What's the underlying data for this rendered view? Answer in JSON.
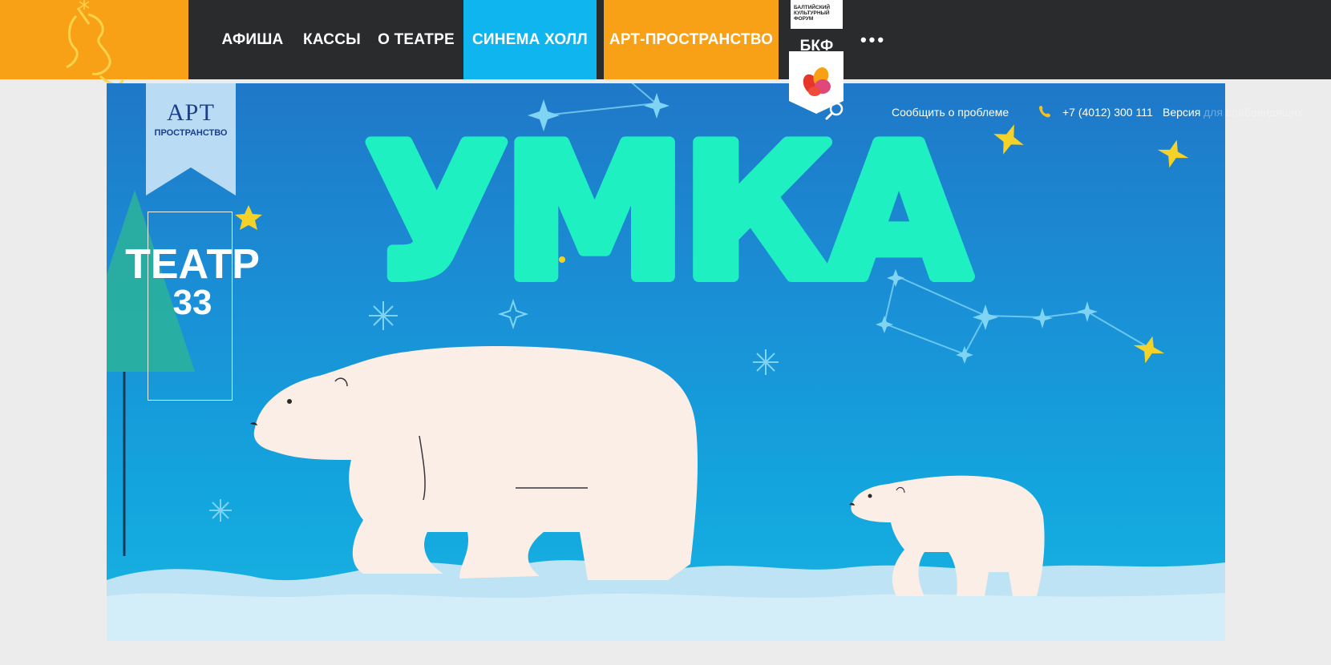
{
  "nav": {
    "items": [
      {
        "label": "АФИША"
      },
      {
        "label": "КАССЫ"
      },
      {
        "label": "О ТЕАТРЕ"
      },
      {
        "label": "СИНЕМА ХОЛЛ"
      },
      {
        "label": "АРТ-ПРОСТРАНСТВО"
      },
      {
        "label": "БКФ"
      }
    ],
    "more_label": "•••",
    "bkf_badge": "БАЛТИЙСКИЙ КУЛЬТУРНЫЙ ФОРУМ"
  },
  "utility": {
    "report": "Сообщить о проблеме",
    "phone": "+7 (4012) 300 111",
    "accessibility_visible": "Версия",
    "accessibility_faded": "для слабовидящих"
  },
  "hero": {
    "title": "УМКА",
    "ribbon_line1": "АРТ",
    "ribbon_line2": "ПРОСТРАНСТВО",
    "theatre_line1": "ТЕАТР",
    "theatre_line2": "33"
  },
  "colors": {
    "orange": "#f8a116",
    "cyan": "#0fb5ef",
    "dark": "#2a2b2c",
    "title_green": "#1ef0c2",
    "bear": "#fbeee6"
  }
}
